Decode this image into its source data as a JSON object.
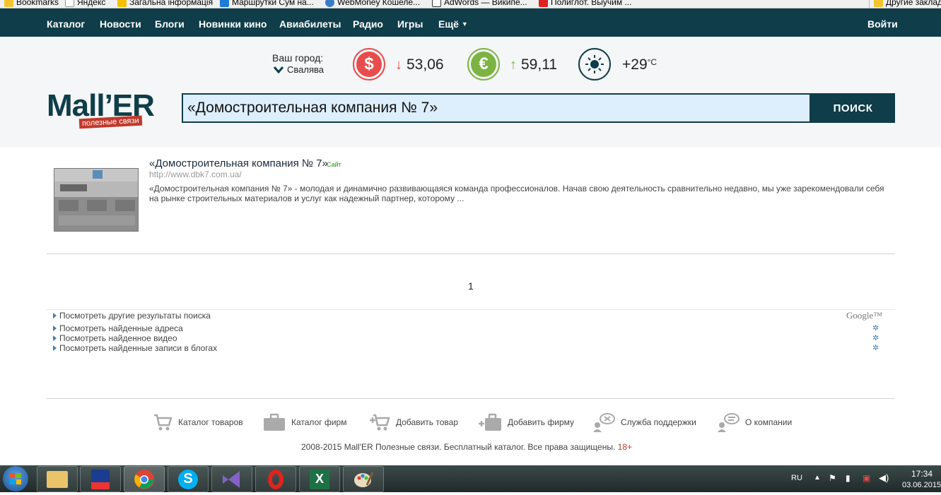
{
  "bookmarks": [
    {
      "label": "Bookmarks",
      "color": "#f4c430"
    },
    {
      "label": "Яндекс",
      "color": "#ffffff"
    },
    {
      "label": "Загальна інформація",
      "color": "#f2c200"
    },
    {
      "label": "Маршрутки Сум на...",
      "color": "#1e7bd6"
    },
    {
      "label": "WebMoney Кошеле...",
      "color": "#3a7bc8"
    },
    {
      "label": "AdWords — Википе...",
      "color": "#ffffff"
    },
    {
      "label": "Полиглот. Выучим ...",
      "color": "#d22"
    },
    {
      "label": "Другие заклад",
      "color": "#f4c430"
    }
  ],
  "nav": {
    "items": [
      "Каталог",
      "Новости",
      "Блоги",
      "Новинки кино",
      "Авиабилеты",
      "Радио",
      "Игры",
      "Ещё"
    ],
    "login": "Войти"
  },
  "header": {
    "city_label": "Ваш город:",
    "city_value": "Свалява",
    "usd_rate": "53,06",
    "eur_rate": "59,11",
    "temperature": "+29",
    "temp_unit": "°C",
    "colors": {
      "usd": "#e84c4c",
      "eur": "#7cb342",
      "weather": "#0f3d4a"
    }
  },
  "logo": {
    "text": "Mall’ER",
    "tagline": "полезные связи"
  },
  "search": {
    "value": "«Домостроительная компания № 7»",
    "button": "ПОИСК"
  },
  "result": {
    "title": "«Домостроительная компания № 7»",
    "tag": "Сайт",
    "url": "http://www.dbk7.com.ua/",
    "description": "«Домостроительная компания № 7» - молодая и динамично развивающаяся команда профессионалов. Начав свою деятельность сравнительно недавно, мы уже зарекомендовали себя на рынке строительных материалов и услуг как надежный партнер, которому ..."
  },
  "pagination": {
    "current": "1"
  },
  "more_links": [
    "Посмотреть другие результаты поиска",
    "Посмотреть найденные адреса",
    "Посмотреть найденное видео",
    "Посмотреть найденные записи в блогах"
  ],
  "google_label": "Google™",
  "footer": {
    "links": [
      {
        "label": "Каталог товаров",
        "icon": "cart-icon"
      },
      {
        "label": "Каталог фирм",
        "icon": "briefcase-icon"
      },
      {
        "label": "Добавить товар",
        "icon": "add-cart-icon"
      },
      {
        "label": "Добавить фирму",
        "icon": "add-briefcase-icon"
      },
      {
        "label": "Служба поддержки",
        "icon": "support-icon"
      },
      {
        "label": "О компании",
        "icon": "about-icon"
      }
    ],
    "copyright": "2008-2015 Mall'ER Полезные связи. Бесплатный каталог. Все права защищены.",
    "age": "18+"
  },
  "taskbar": {
    "lang": "RU",
    "time": "17:34",
    "date": "03.06.2015"
  }
}
